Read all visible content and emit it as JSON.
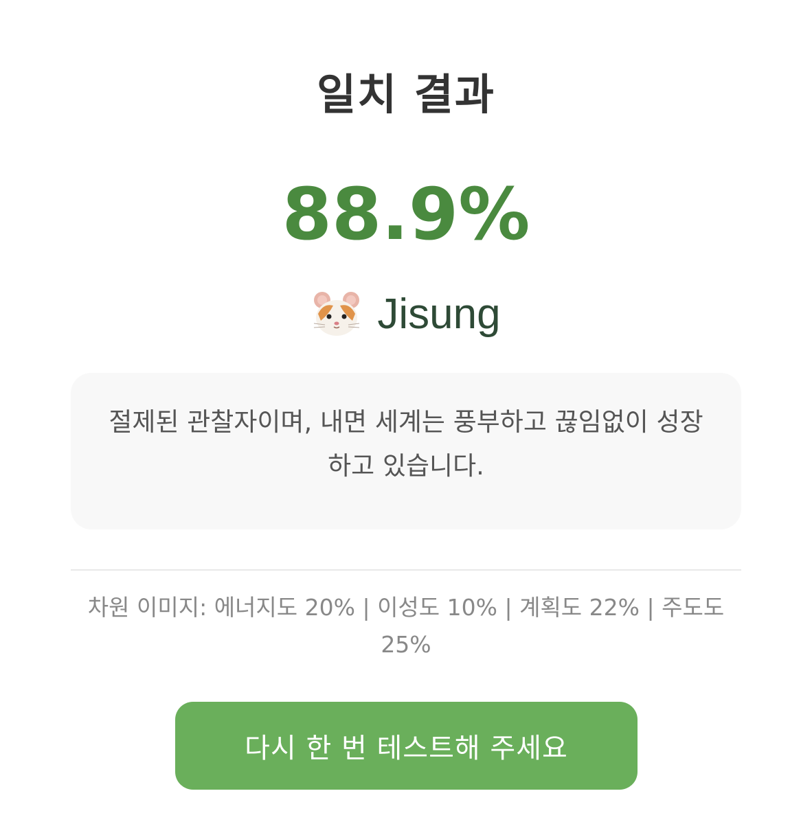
{
  "result": {
    "title": "일치 결과",
    "score": "88.9%",
    "character": {
      "icon": "hamster-icon",
      "name": "Jisung"
    },
    "description": "절제된 관찰자이며, 내면 세계는 풍부하고 끊임없이 성장하고 있습니다.",
    "dimensions_text": "차원 이미지: 에너지도 20% | 이성도 10% | 계획도 22% | 주도도 25%",
    "retry_label": "다시 한 번 테스트해 주세요"
  },
  "colors": {
    "accent": "#4a8a3f",
    "button": "#6aaf5b",
    "name_text": "#2e4a36",
    "card_bg": "#f8f8f8"
  }
}
